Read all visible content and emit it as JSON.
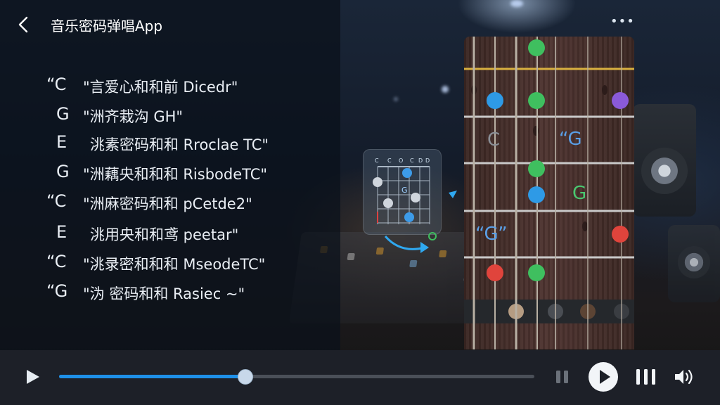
{
  "header": {
    "title": "音乐密码弹唱App",
    "back_icon": "chevron-left-icon",
    "more_icon": "more-horizontal-icon",
    "more_glyph": "•••"
  },
  "chord_list": [
    {
      "chord": "“C",
      "desc": "\"言爱心和和前 Dicedr\""
    },
    {
      "chord": "G",
      "desc": "\"洲齐栽沟 GH\""
    },
    {
      "chord": "E",
      "desc": "洮素密码和和 Rroclae TC\""
    },
    {
      "chord": "G",
      "desc": "\"洲藕央和和和 RisbodeTC\""
    },
    {
      "chord": "“C",
      "desc": "\"洲麻密码和和 pCetde2\""
    },
    {
      "chord": "E",
      "desc": "洮用央和和鸢 peetar\""
    },
    {
      "chord": "“C",
      "desc": "\"洮录密和和和 MseodeTC\""
    },
    {
      "chord": "“G",
      "desc": "\"沩 密码和和 Rasiec ~\""
    }
  ],
  "mini_chord": {
    "string_labels": [
      "C",
      "C",
      "O",
      "C",
      "D",
      "D"
    ],
    "center_label": "G"
  },
  "fretboard": {
    "labels": [
      {
        "text": "C",
        "color": "#8a8f96"
      },
      {
        "text": "“G",
        "color": "#5aa0e8"
      },
      {
        "text": "G",
        "color": "#4ac870"
      },
      {
        "text": "“G”",
        "color": "#5aa0e8"
      }
    ]
  },
  "player": {
    "progress": 0.39,
    "play_icon": "play-icon",
    "pause_icon": "pause-icon",
    "play_circle_icon": "play-circle-icon",
    "bars_icon": "equalizer-bars-icon",
    "volume_icon": "volume-icon"
  },
  "colors": {
    "accent": "#1e90e8",
    "dot_green": "#3fbf5f",
    "dot_blue": "#2e9ae6",
    "dot_purple": "#8a5ad8",
    "dot_red": "#e0443c"
  }
}
